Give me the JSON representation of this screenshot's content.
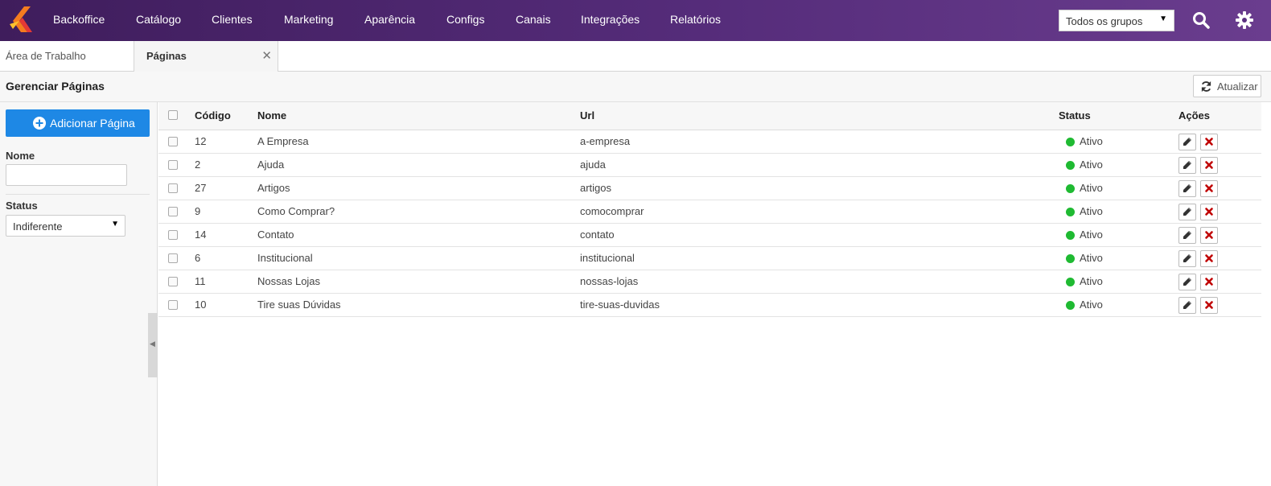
{
  "colors": {
    "nav_bg": "#4a2369",
    "primary": "#1e88e5",
    "status_active": "#1fba32",
    "delete": "#c00000"
  },
  "nav": {
    "items": [
      "Backoffice",
      "Catálogo",
      "Clientes",
      "Marketing",
      "Aparência",
      "Configs",
      "Canais",
      "Integrações",
      "Relatórios"
    ],
    "group_select": "Todos os grupos",
    "icons": [
      "search-icon",
      "gear-icon"
    ]
  },
  "tabs": [
    {
      "label": "Área de Trabalho",
      "active": false
    },
    {
      "label": "Páginas",
      "active": true
    }
  ],
  "header": {
    "title": "Gerenciar Páginas",
    "refresh_label": "Atualizar"
  },
  "sidebar": {
    "add_button": "Adicionar Página",
    "name_label": "Nome",
    "name_value": "",
    "status_label": "Status",
    "status_value": "Indiferente"
  },
  "table": {
    "columns": {
      "code": "Código",
      "name": "Nome",
      "url": "Url",
      "status": "Status",
      "actions": "Ações"
    },
    "rows": [
      {
        "code": "12",
        "name": "A Empresa",
        "url": "a-empresa",
        "status": "Ativo"
      },
      {
        "code": "2",
        "name": "Ajuda",
        "url": "ajuda",
        "status": "Ativo"
      },
      {
        "code": "27",
        "name": "Artigos",
        "url": "artigos",
        "status": "Ativo"
      },
      {
        "code": "9",
        "name": "Como Comprar?",
        "url": "comocomprar",
        "status": "Ativo"
      },
      {
        "code": "14",
        "name": "Contato",
        "url": "contato",
        "status": "Ativo"
      },
      {
        "code": "6",
        "name": "Institucional",
        "url": "institucional",
        "status": "Ativo"
      },
      {
        "code": "11",
        "name": "Nossas Lojas",
        "url": "nossas-lojas",
        "status": "Ativo"
      },
      {
        "code": "10",
        "name": "Tire suas Dúvidas",
        "url": "tire-suas-duvidas",
        "status": "Ativo"
      }
    ]
  }
}
